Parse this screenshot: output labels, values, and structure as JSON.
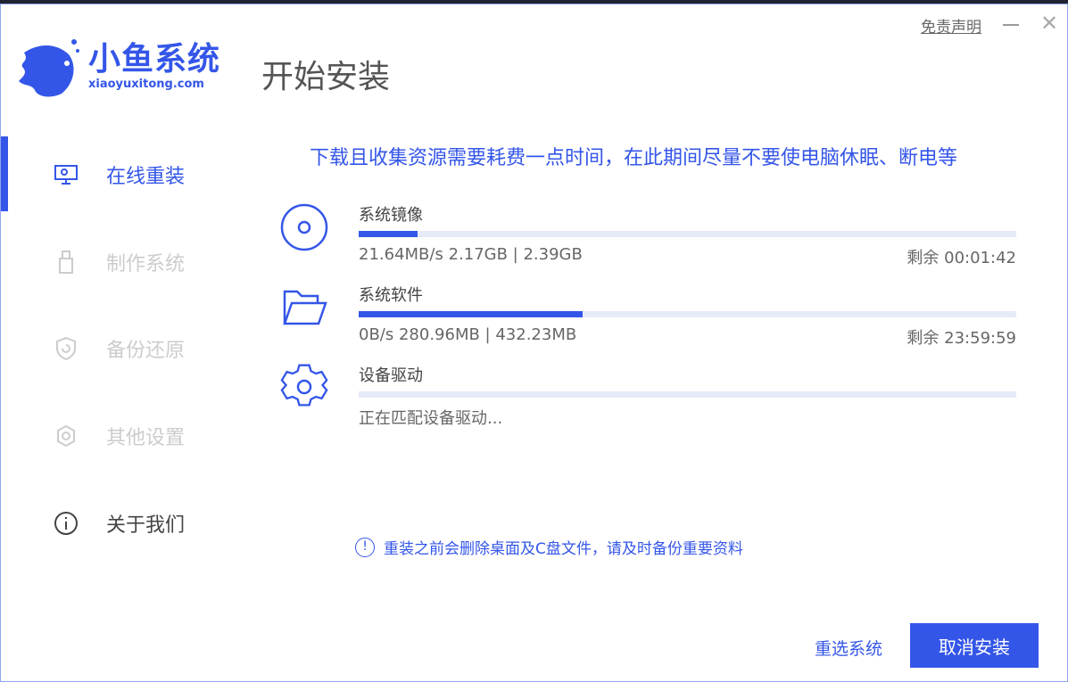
{
  "app": {
    "logo_cn": "小鱼系统",
    "logo_en": "xiaoyuxitong.com",
    "page_title": "开始安装",
    "disclaimer": "免责声明"
  },
  "sidebar": {
    "items": [
      {
        "label": "在线重装",
        "icon": "monitor-icon",
        "state": "active"
      },
      {
        "label": "制作系统",
        "icon": "usb-icon",
        "state": "disabled"
      },
      {
        "label": "备份还原",
        "icon": "shield-restore-icon",
        "state": "disabled"
      },
      {
        "label": "其他设置",
        "icon": "gear-icon",
        "state": "disabled"
      },
      {
        "label": "关于我们",
        "icon": "info-icon",
        "state": "normal"
      }
    ]
  },
  "main": {
    "notice": "下载且收集资源需要耗费一点时间，在此期间尽量不要使电脑休眠、断电等",
    "tasks": [
      {
        "name": "系统镜像",
        "icon": "disc-icon",
        "progress_pct": 9,
        "stat": "21.64MB/s 2.17GB | 2.39GB",
        "remain": "剩余 00:01:42"
      },
      {
        "name": "系统软件",
        "icon": "folder-icon",
        "progress_pct": 34,
        "stat": "0B/s 280.96MB | 432.23MB",
        "remain": "剩余 23:59:59"
      },
      {
        "name": "设备驱动",
        "icon": "gear-icon",
        "progress_pct": 0,
        "stat": "正在匹配设备驱动..."
      }
    ],
    "warning": "重装之前会删除桌面及C盘文件，请及时备份重要资料",
    "warning_icon": "!",
    "reselect_label": "重选系统",
    "cancel_label": "取消安装"
  },
  "colors": {
    "accent": "#3456e8",
    "track": "#e6ebf7"
  }
}
